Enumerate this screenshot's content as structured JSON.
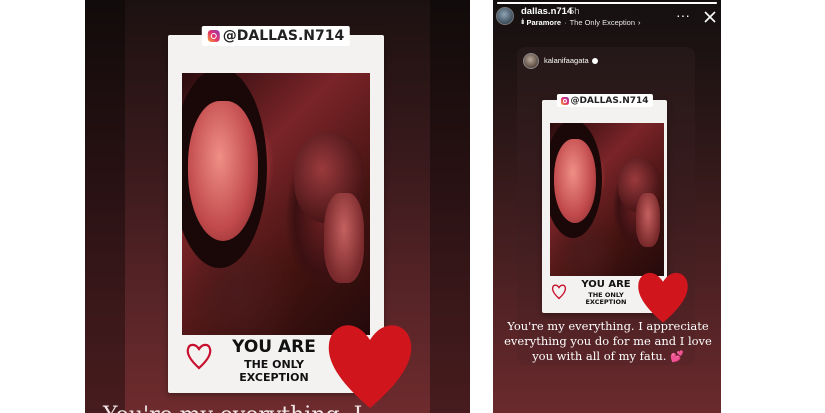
{
  "left_story": {
    "handle_tag": "@DALLAS.N714",
    "caption_line1": "YOU ARE",
    "caption_line2": "THE ONLY",
    "caption_line3": "EXCEPTION",
    "partial_caption": "You're my everything. I"
  },
  "right_story": {
    "username": "dallas.n714",
    "time_ago": "5h",
    "music_icon": "music-bars-icon",
    "music_artist": "Paramore",
    "music_separator": "·",
    "music_song": "The Only Exception",
    "music_chevron": "›",
    "more_label": "···",
    "progress": 1.0,
    "shared_post": {
      "username": "kalanifaagata",
      "verified": true,
      "handle_tag": "@DALLAS.N714",
      "caption_line1": "YOU ARE",
      "caption_line2": "THE ONLY",
      "caption_line3": "EXCEPTION"
    },
    "caption": "You're my everything. I appreciate everything you do for me and I love you with all of my fatu.",
    "caption_emoji": "💕"
  },
  "colors": {
    "heart_red": "#d0161c",
    "heart_outline": "#c8102e",
    "background_dark": "#2a1616"
  }
}
